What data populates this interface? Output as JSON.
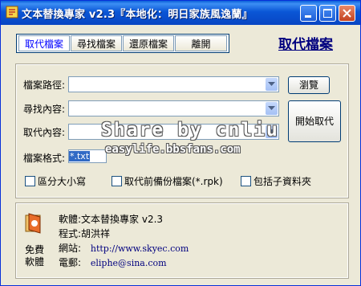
{
  "window": {
    "title": "文本替換專家 v2.3『本地化：明日家族風逸蘭』"
  },
  "toolbar": {
    "tabs": [
      "取代檔案",
      "尋找檔案",
      "還原檔案",
      "離開"
    ]
  },
  "headline": "取代檔案",
  "form": {
    "path_label": "檔案路徑:",
    "find_label": "尋找內容:",
    "replace_label": "取代內容:",
    "format_label": "檔案格式:",
    "format_value": "*.txt",
    "path_value": "",
    "find_value": "",
    "replace_value": ""
  },
  "buttons": {
    "browse": "瀏覽",
    "start": "開始取代"
  },
  "options": [
    "區分大小寫",
    "取代前備份檔案(*.rpk)",
    "包括子資料夾"
  ],
  "info": {
    "software_label": "軟體:",
    "software_value": "文本替換專家 v2.3",
    "programmer_label": "程式:",
    "programmer_value": "胡洪祥",
    "site_label": "網站:",
    "site_value": "http://www.skyec.com",
    "email_label": "電郵:",
    "email_value": "eliphe@sina.com",
    "free_line1": "免費",
    "free_line2": "軟體"
  },
  "watermark": {
    "line1": "Share by cnliu",
    "line2": "easylife.bbsfans.com"
  }
}
